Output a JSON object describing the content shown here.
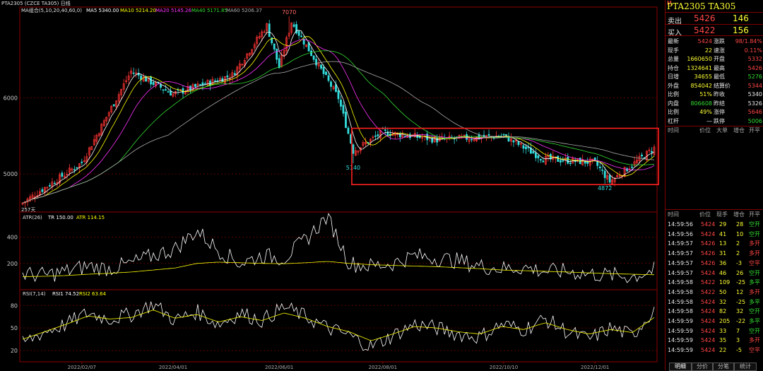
{
  "header": {
    "symbol": "PTA2305",
    "exchange_name": "(CZCE TA305)",
    "period": "日线",
    "ma_label": "MA组合(5,10,20,40,60,0)",
    "ma5": "MA5 5340.00",
    "ma10": "MA10 5214.20",
    "ma20": "MA20 5145.26",
    "ma40": "MA40 5171.85",
    "ma60": "MA60 5206.37",
    "atr_label": "ATR(26)",
    "atr_tr": "TR 150.00",
    "atr_val": "ATR 114.15",
    "rsi_label": "RSI(7,14)",
    "rsi1": "RSI1 74.52",
    "rsi2": "RSI2 63.64",
    "bar_count": "257天"
  },
  "colors": {
    "ma5": "#ffffff",
    "ma10": "#ffff00",
    "ma20": "#ff33ff",
    "ma40": "#33dd33",
    "ma60": "#aaaaaa",
    "up_candle": "#ff3333",
    "down_candle": "#33dddd",
    "frame": "#8b0000",
    "highlight_box": "#ff2020"
  },
  "chart_data": [
    {
      "type": "candlestick",
      "title": "PTA2305 日线",
      "y_ticks": [
        5000,
        6000
      ],
      "x_ticks": [
        "2022/02/07",
        "2022/04/01",
        "2022/06/01",
        "2022/08/01",
        "2022/10/10",
        "2022/12/01"
      ],
      "x_range": [
        "2022/01/04",
        "2023/01/05"
      ],
      "ylim": [
        4500,
        7100
      ],
      "key_points": [
        {
          "date": "2022/01/04",
          "close": 4620
        },
        {
          "date": "2022/02/07",
          "close": 5150
        },
        {
          "date": "2022/03/08",
          "close": 6350
        },
        {
          "date": "2022/04/01",
          "close": 6050
        },
        {
          "date": "2022/05/06",
          "close": 6300
        },
        {
          "date": "2022/05/25",
          "close": 6950
        },
        {
          "date": "2022/06/01",
          "close": 6400
        },
        {
          "date": "2022/06/09",
          "close": 7000
        },
        {
          "date": "2022/07/06",
          "close": 6000
        },
        {
          "date": "2022/07/15",
          "close": 5300
        },
        {
          "date": "2022/08/01",
          "close": 5550
        },
        {
          "date": "2022/09/01",
          "close": 5450
        },
        {
          "date": "2022/10/10",
          "close": 5500
        },
        {
          "date": "2022/11/01",
          "close": 5200
        },
        {
          "date": "2022/12/01",
          "close": 5150
        },
        {
          "date": "2022/12/10",
          "close": 4900
        },
        {
          "date": "2023/01/05",
          "close": 5340
        }
      ],
      "annotations": [
        {
          "text": "7070",
          "date": "2022/06/08",
          "value": 7070
        },
        {
          "text": "5140",
          "date": "2022/07/15",
          "value": 5140
        },
        {
          "text": "4872",
          "date": "2022/12/08",
          "value": 4872
        }
      ],
      "highlight_region": {
        "date_from": "2022/07/14",
        "date_to": "2023/01/05",
        "value_from": 4860,
        "value_to": 5600
      }
    },
    {
      "type": "line",
      "title": "ATR(26)",
      "y_ticks": [
        200,
        400
      ],
      "ylim": [
        0,
        580
      ],
      "series": [
        {
          "name": "TR",
          "values": [
            120,
            110,
            140,
            180,
            160,
            200,
            260,
            310,
            450,
            300,
            200,
            260,
            240,
            380,
            560,
            200,
            180,
            200,
            260,
            240,
            220,
            180,
            160,
            170,
            140,
            140,
            120,
            110,
            100,
            150
          ]
        },
        {
          "name": "ATR",
          "values": [
            100,
            102,
            108,
            118,
            125,
            135,
            150,
            165,
            200,
            210,
            205,
            200,
            198,
            205,
            215,
            200,
            190,
            185,
            180,
            175,
            168,
            160,
            150,
            145,
            140,
            135,
            128,
            122,
            118,
            114
          ]
        }
      ]
    },
    {
      "type": "line",
      "title": "RSI(7,14)",
      "y_ticks": [
        20,
        50,
        80
      ],
      "ylim": [
        5,
        100
      ],
      "series": [
        {
          "name": "RSI1",
          "values": [
            30,
            45,
            55,
            70,
            62,
            68,
            82,
            60,
            72,
            55,
            70,
            60,
            78,
            65,
            50,
            40,
            25,
            40,
            55,
            50,
            42,
            38,
            55,
            48,
            62,
            45,
            35,
            50,
            40,
            75
          ]
        },
        {
          "name": "RSI2",
          "values": [
            35,
            45,
            55,
            66,
            62,
            64,
            74,
            63,
            68,
            58,
            65,
            60,
            70,
            63,
            52,
            45,
            33,
            42,
            52,
            50,
            45,
            42,
            52,
            48,
            57,
            48,
            42,
            48,
            44,
            64
          ]
        }
      ]
    }
  ],
  "side": {
    "title": "PTA2305  TA305",
    "sell_label": "卖出",
    "sell_price": "5426",
    "sell_vol": "146",
    "buy_label": "买入",
    "buy_price": "5422",
    "buy_vol": "156",
    "quote": [
      [
        "最新",
        "5424",
        "涨跌",
        "98/1.84%"
      ],
      [
        "现手",
        "22",
        "速涨",
        "0.11%"
      ],
      [
        "总量",
        "1660650",
        "开盘",
        "5332"
      ],
      [
        "持仓",
        "1324641",
        "最高",
        "5426"
      ],
      [
        "日增",
        "34655",
        "最低",
        "5276"
      ],
      [
        "外盘",
        "854042",
        "结算价",
        "5344"
      ],
      [
        "比例",
        "51%",
        "昨收",
        "5340"
      ],
      [
        "内盘",
        "806608",
        "昨结",
        "5326"
      ],
      [
        "比例",
        "49%",
        "涨停",
        "5646"
      ],
      [
        "杠杆",
        "—",
        "跌停",
        "5006"
      ]
    ],
    "tick_header1": [
      "时间",
      "价位",
      "大单",
      "增仓",
      "开平"
    ],
    "tick_header2": [
      "时间",
      "价位",
      "现手",
      "增仓",
      "开平"
    ],
    "ticks": [
      [
        "14:59:56",
        "5424",
        "29",
        "28",
        "空开"
      ],
      [
        "14:59:56",
        "5424",
        "41",
        "10",
        "空开"
      ],
      [
        "14:59:57",
        "5426",
        "13",
        "2",
        "多开"
      ],
      [
        "14:59:57",
        "5426",
        "31",
        "2",
        "多开"
      ],
      [
        "14:59:57",
        "5426",
        "36",
        "-3",
        "空平"
      ],
      [
        "14:59:57",
        "5424",
        "46",
        "26",
        "空开"
      ],
      [
        "14:59:58",
        "5422",
        "109",
        "-25",
        "多平"
      ],
      [
        "14:59:58",
        "5422",
        "50",
        "12",
        "多开"
      ],
      [
        "14:59:58",
        "5424",
        "32",
        "-25",
        "多平"
      ],
      [
        "14:59:58",
        "5424",
        "82",
        "32",
        "空开"
      ],
      [
        "14:59:59",
        "5424",
        "205",
        "-22",
        "多平"
      ],
      [
        "14:59:59",
        "5424",
        "33",
        "7",
        "空开"
      ],
      [
        "14:59:59",
        "5424",
        "35",
        "3",
        "多开"
      ],
      [
        "14:59:59",
        "5424",
        "22",
        "-5",
        "空平"
      ]
    ],
    "tabs": [
      "明细",
      "分价",
      "分笔",
      "统计"
    ]
  }
}
